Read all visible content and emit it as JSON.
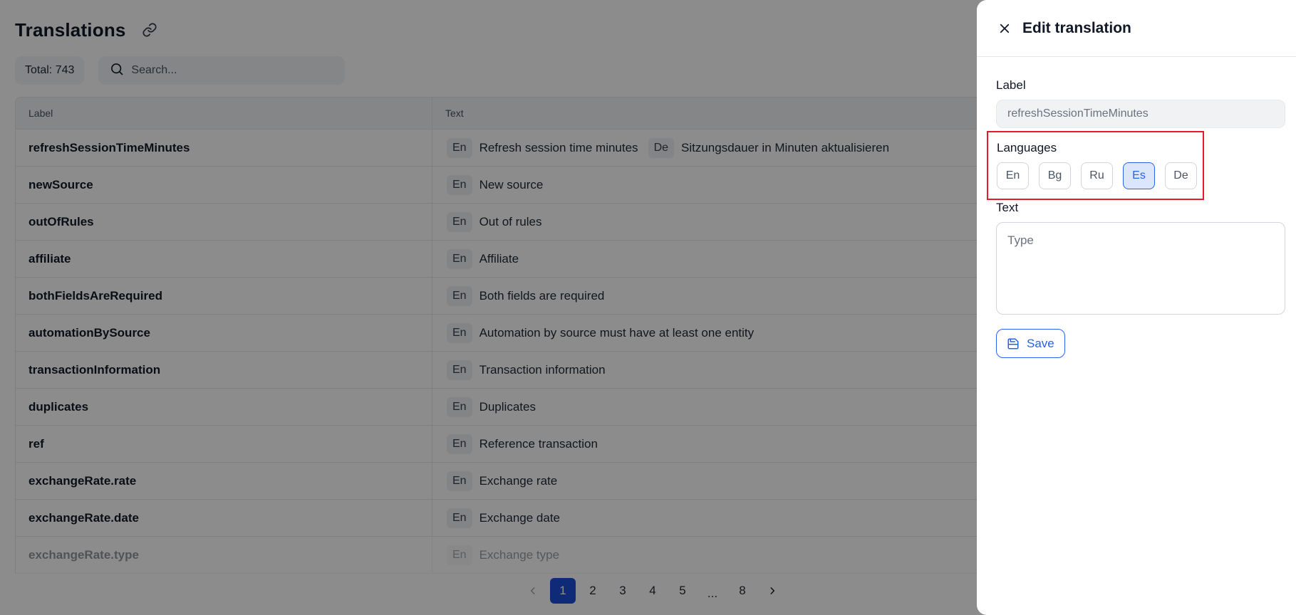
{
  "page": {
    "title": "Translations",
    "total": "Total: 743",
    "search_placeholder": "Search..."
  },
  "table": {
    "columns": {
      "label": "Label",
      "text": "Text"
    },
    "rows": [
      {
        "label": "refreshSessionTimeMinutes",
        "translations": [
          {
            "lang": "En",
            "value": "Refresh session time minutes"
          },
          {
            "lang": "De",
            "value": "Sitzungsdauer in Minuten aktualisieren"
          }
        ]
      },
      {
        "label": "newSource",
        "translations": [
          {
            "lang": "En",
            "value": "New source"
          }
        ]
      },
      {
        "label": "outOfRules",
        "translations": [
          {
            "lang": "En",
            "value": "Out of rules"
          }
        ]
      },
      {
        "label": "affiliate",
        "translations": [
          {
            "lang": "En",
            "value": "Affiliate"
          }
        ]
      },
      {
        "label": "bothFieldsAreRequired",
        "translations": [
          {
            "lang": "En",
            "value": "Both fields are required"
          }
        ]
      },
      {
        "label": "automationBySource",
        "translations": [
          {
            "lang": "En",
            "value": "Automation by source must have at least one entity"
          }
        ]
      },
      {
        "label": "transactionInformation",
        "translations": [
          {
            "lang": "En",
            "value": "Transaction information"
          }
        ]
      },
      {
        "label": "duplicates",
        "translations": [
          {
            "lang": "En",
            "value": "Duplicates"
          }
        ]
      },
      {
        "label": "ref",
        "translations": [
          {
            "lang": "En",
            "value": "Reference transaction"
          }
        ]
      },
      {
        "label": "exchangeRate.rate",
        "translations": [
          {
            "lang": "En",
            "value": "Exchange rate"
          }
        ]
      },
      {
        "label": "exchangeRate.date",
        "translations": [
          {
            "lang": "En",
            "value": "Exchange date"
          }
        ]
      },
      {
        "label": "exchangeRate.type",
        "translations": [
          {
            "lang": "En",
            "value": "Exchange type"
          }
        ]
      }
    ]
  },
  "pagination": {
    "pages": [
      "1",
      "2",
      "3",
      "4",
      "5",
      "...",
      "8"
    ],
    "active": "1"
  },
  "drawer": {
    "title": "Edit translation",
    "label_field": {
      "label": "Label",
      "value": "refreshSessionTimeMinutes"
    },
    "languages": {
      "label": "Languages",
      "options": [
        "En",
        "Bg",
        "Ru",
        "Es",
        "De"
      ],
      "selected": "Es"
    },
    "text_field": {
      "label": "Text",
      "placeholder": "Type"
    },
    "save_label": "Save"
  },
  "colors": {
    "accent": "#1d4ed8",
    "highlight_border": "#e11d2a",
    "overlay": "rgba(0,0,0,0.45)"
  },
  "icons": {
    "title_link": "link-icon",
    "search": "search-icon",
    "close": "close-icon",
    "save": "save-icon",
    "prev": "chevron-left-icon",
    "next": "chevron-right-icon"
  }
}
